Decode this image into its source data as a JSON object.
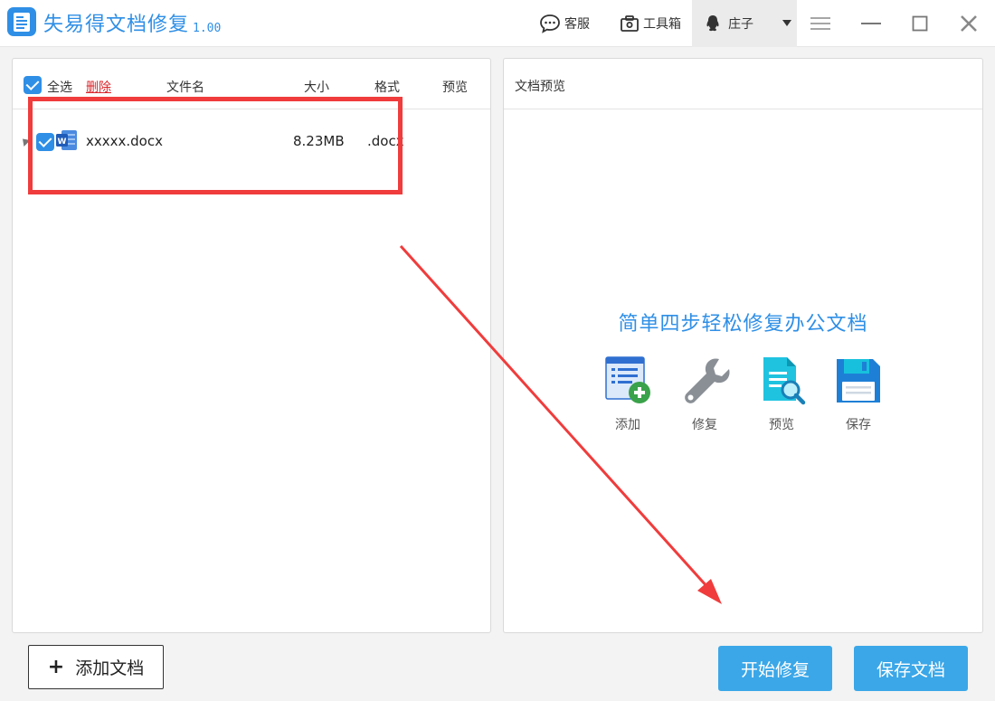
{
  "app": {
    "title": "失易得文档修复",
    "version": "1.00"
  },
  "toolbar": {
    "service_label": "客服",
    "toolbox_label": "工具箱",
    "user_name": "庄子"
  },
  "file_list": {
    "select_all_label": "全选",
    "delete_label": "删除",
    "columns": {
      "name": "文件名",
      "size": "大小",
      "format": "格式",
      "preview": "预览"
    },
    "rows": [
      {
        "name": "xxxxx.docx",
        "size": "8.23MB",
        "format": ".docx",
        "checked": true
      }
    ]
  },
  "preview": {
    "header": "文档预览",
    "title": "简单四步轻松修复办公文档",
    "steps": [
      {
        "label": "添加",
        "icon": "add-doc-icon"
      },
      {
        "label": "修复",
        "icon": "wrench-icon"
      },
      {
        "label": "预览",
        "icon": "preview-doc-icon"
      },
      {
        "label": "保存",
        "icon": "save-disk-icon"
      }
    ]
  },
  "buttons": {
    "add_doc": "添加文档",
    "start_repair": "开始修复",
    "save_doc": "保存文档"
  },
  "colors": {
    "brand": "#2f8fe6",
    "button": "#3ba7e8",
    "annotation": "#f03c3c",
    "delete": "#d8262c"
  }
}
